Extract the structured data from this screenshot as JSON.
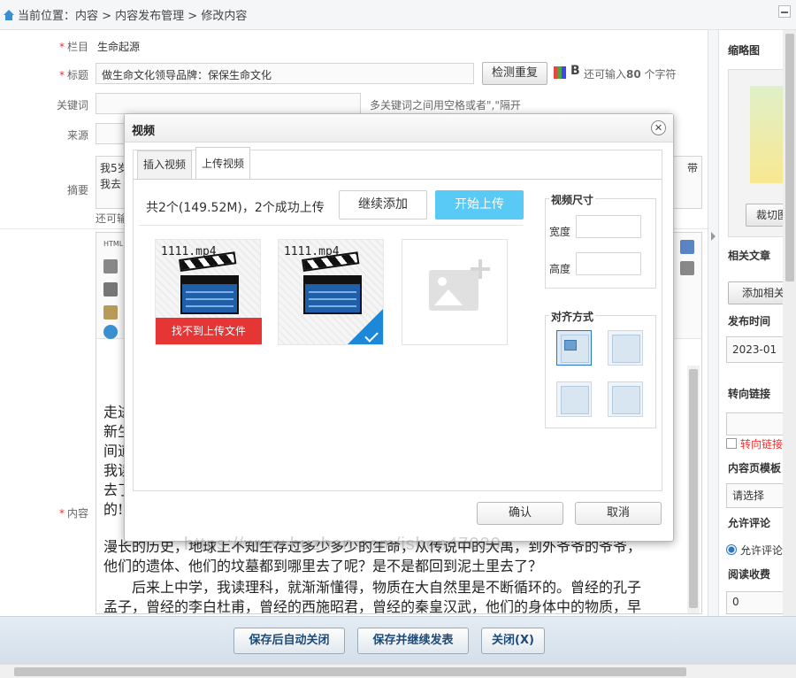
{
  "breadcrumb": {
    "text": "当前位置：内容 > 内容发布管理 > 修改内容"
  },
  "form": {
    "column_label": "栏目",
    "column_value": "生命起源",
    "title_label": "标题",
    "title_value": "做生命文化领导品牌：保保生命文化",
    "check_dup_button": "检测重复",
    "title_hint": "还可输入",
    "title_hint_count": "80",
    "title_hint_unit": "个字符",
    "keywords_label": "关键词",
    "keywords_hint": "多关键词之间用空格或者\",\"隔开",
    "source_label": "来源",
    "summary_label": "摘要",
    "summary_line1": "我5岁",
    "summary_line2": "我去",
    "summary_right": "带",
    "summary_hint": "还可输",
    "content_label": "内容"
  },
  "editor": {
    "para_fragments": [
      "走进",
      "新生",
      "间道",
      "我读",
      "去了",
      "的!"
    ],
    "line1": "漫长的历史，地球上不知生存过多少多少的生命，从传说中的大禹，到外爷爷的爷爷，",
    "line2": "他们的遗体、他们的坟墓都到哪里去了呢？是不是都回到泥土里去了？",
    "line3": "后来上中学，我读理科，就渐渐懂得，物质在大自然里是不断循环的。曾经的孔子",
    "line4": "孟子，曾经的李白杜甫，曾经的西施昭君，曾经的秦皇汉武，他们的身体中的物质，早"
  },
  "right_panel": {
    "thumbnail_label": "缩略图",
    "crop_button": "裁切图",
    "related_label": "相关文章",
    "add_related_button": "添加相关",
    "publish_time_label": "发布时间",
    "publish_time_value": "2023-01",
    "redirect_label": "转向链接",
    "redirect_checkbox": "转向链接",
    "template_label": "内容页模板",
    "template_select": "请选择",
    "comment_label": "允许评论",
    "comment_option": "允许评论",
    "fee_label": "阅读收费",
    "fee_value": "0"
  },
  "dialog": {
    "title": "视频",
    "tab_insert": "插入视频",
    "tab_upload": "上传视频",
    "status": "共2个(149.52M)，2个成功上传",
    "continue_add": "继续添加",
    "start_upload": "开始上传",
    "files": [
      {
        "name": "1111.mp4",
        "error": "找不到上传文件"
      },
      {
        "name": "1111.mp4"
      }
    ],
    "size_title": "视频尺寸",
    "width_label": "宽度",
    "height_label": "高度",
    "align_title": "对齐方式",
    "ok": "确认",
    "cancel": "取消"
  },
  "footer": {
    "save_close": "保存后自动关闭",
    "save_continue": "保存并继续发表",
    "close": "关闭(X)"
  },
  "watermark": "https://www.huzhan.com/ishop47020"
}
